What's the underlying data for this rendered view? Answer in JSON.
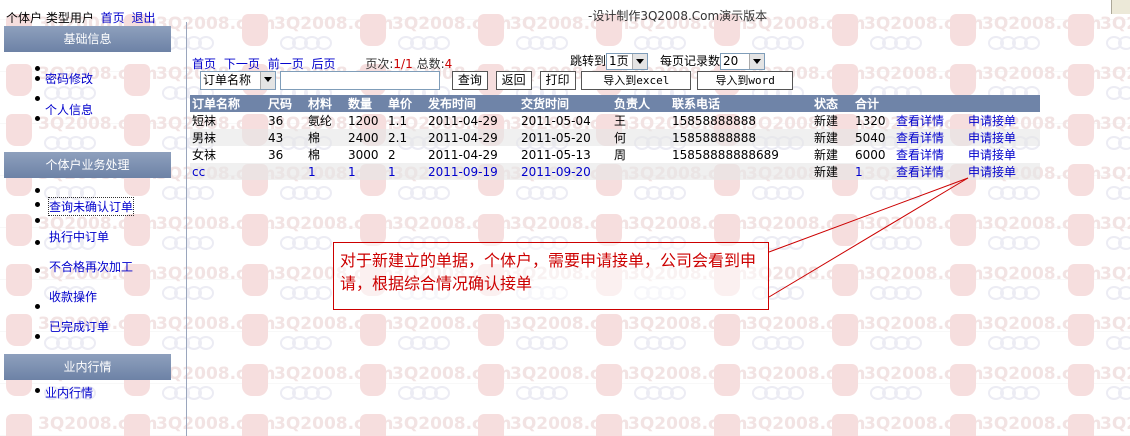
{
  "topbar": {
    "user_info": "个体户 类型用户",
    "home_link": "首页",
    "logout_link": "退出",
    "credit": "-设计制作3Q2008.Com演示版本"
  },
  "watermark": {
    "text": "3Q2008.com"
  },
  "sidebar": {
    "sections": [
      {
        "title": "基础信息",
        "items": [
          {
            "label": "密码修改"
          },
          {
            "label": "个人信息"
          }
        ]
      },
      {
        "title": "个体户业务处理",
        "items": [
          {
            "label": "查询未确认订单"
          },
          {
            "label": "执行中订单"
          },
          {
            "label": "不合格再次加工"
          },
          {
            "label": "收款操作"
          },
          {
            "label": "已完成订单"
          }
        ]
      },
      {
        "title": "业内行情",
        "items": [
          {
            "label": "业内行情"
          }
        ]
      }
    ]
  },
  "pager": {
    "first": "首页",
    "next": "下一页",
    "prev": "前一页",
    "last": "后页",
    "page_label": "页次:",
    "page_value": "1/1",
    "total_label": "总数:",
    "total_value": "4",
    "jump_label": "跳转到",
    "jump_value": "1页",
    "per_page_label": "每页记录数",
    "per_page_value": "20"
  },
  "toolbar": {
    "field_select": "订单名称",
    "search_input_value": "",
    "query_button": "查询",
    "back_button": "返回",
    "print_button": "打印",
    "export_excel_button": "导入到excel",
    "export_word_button": "导入到word"
  },
  "table": {
    "columns": [
      "订单名称",
      "尺码",
      "材料",
      "数量",
      "单价",
      "发布时间",
      "交货时间",
      "负责人",
      "联系电话",
      "状态",
      "合计",
      "",
      ""
    ],
    "rows": [
      {
        "name": "短袜",
        "size": "36",
        "material": "氨纶",
        "qty": "1200",
        "price": "1.1",
        "publish": "2011-04-29",
        "delivery": "2011-05-04",
        "owner": "王",
        "phone": "15858888888",
        "status": "新建",
        "total": "1320",
        "detail": "查看详情",
        "apply": "申请接单"
      },
      {
        "name": "男袜",
        "size": "43",
        "material": "棉",
        "qty": "2400",
        "price": "2.1",
        "publish": "2011-04-29",
        "delivery": "2011-05-20",
        "owner": "何",
        "phone": "15858888888",
        "status": "新建",
        "total": "5040",
        "detail": "查看详情",
        "apply": "申请接单"
      },
      {
        "name": "女袜",
        "size": "36",
        "material": "棉",
        "qty": "3000",
        "price": "2",
        "publish": "2011-04-29",
        "delivery": "2011-05-13",
        "owner": "周",
        "phone": "15858888888689",
        "status": "新建",
        "total": "6000",
        "detail": "查看详情",
        "apply": "申请接单"
      },
      {
        "name": "cc",
        "size": "",
        "material": "1",
        "qty": "1",
        "price": "1",
        "publish": "2011-09-19",
        "delivery": "2011-09-20",
        "owner": "",
        "phone": "",
        "status": "新建",
        "total": "1",
        "detail": "查看详情",
        "apply": "申请接单"
      }
    ]
  },
  "callout": {
    "text": "对于新建立的单据，个体户，需要申请接单，公司会看到申请，根据综合情况确认接单",
    "border_color": "#cc0000"
  },
  "colors": {
    "header_bg": "#6f84a8",
    "link": "#0000cc",
    "accent_red": "#cc0000"
  }
}
